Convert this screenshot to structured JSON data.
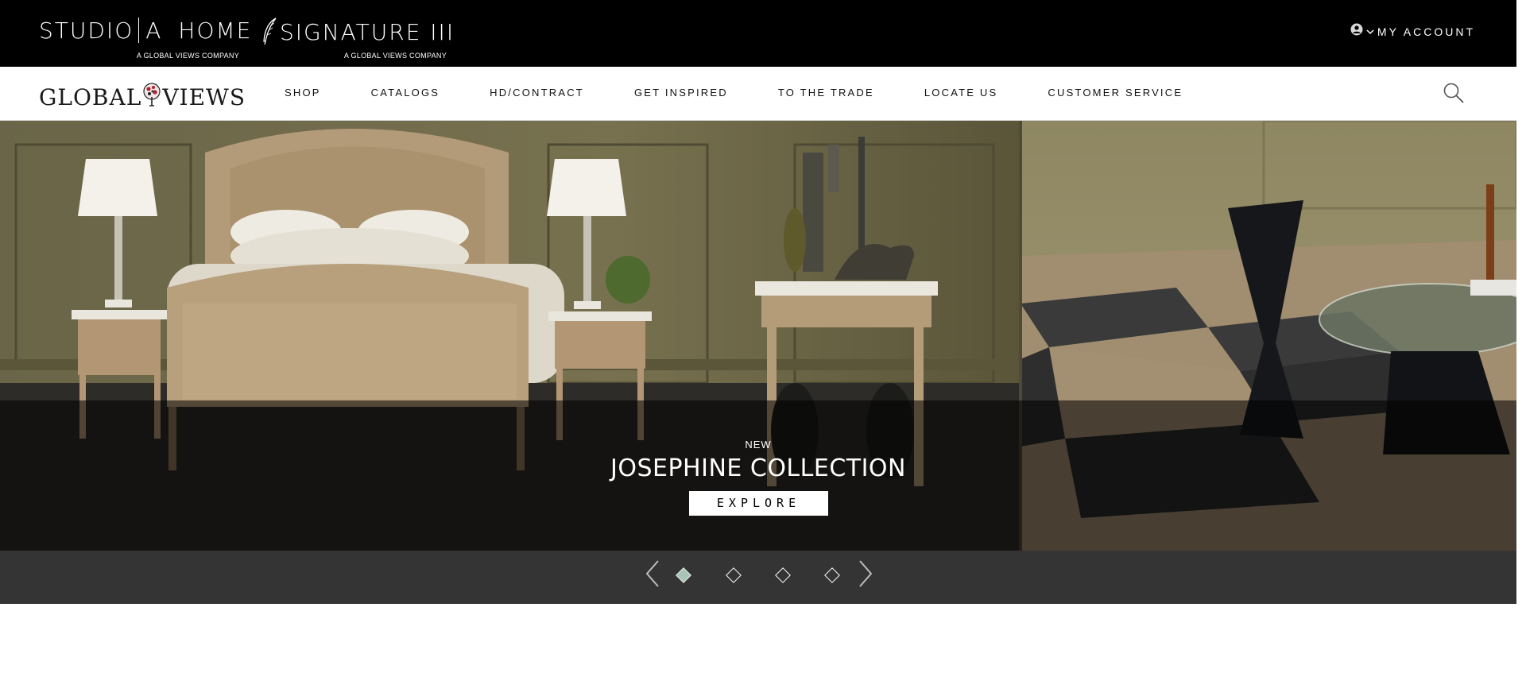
{
  "brands": {
    "studio_a": {
      "left": "STUDIO",
      "right": "A",
      "home": "HOME",
      "sub": "A GLOBAL VIEWS COMPANY"
    },
    "signature": {
      "name": "SIGNATURE III",
      "sub": "A GLOBAL VIEWS COMPANY"
    }
  },
  "account": {
    "label": "MY ACCOUNT",
    "icon": "user-circle-icon"
  },
  "logo": {
    "left": "GLOBAL",
    "right": "VIEWS"
  },
  "nav": {
    "items": [
      "SHOP",
      "CATALOGS",
      "HD/CONTRACT",
      "GET INSPIRED",
      "TO THE TRADE",
      "LOCATE US",
      "CUSTOMER SERVICE"
    ]
  },
  "hero": {
    "kicker": "NEW",
    "title": "JOSEPHINE COLLECTION",
    "cta": "EXPLORE"
  },
  "slider": {
    "slides": 4,
    "active_index": 0
  }
}
